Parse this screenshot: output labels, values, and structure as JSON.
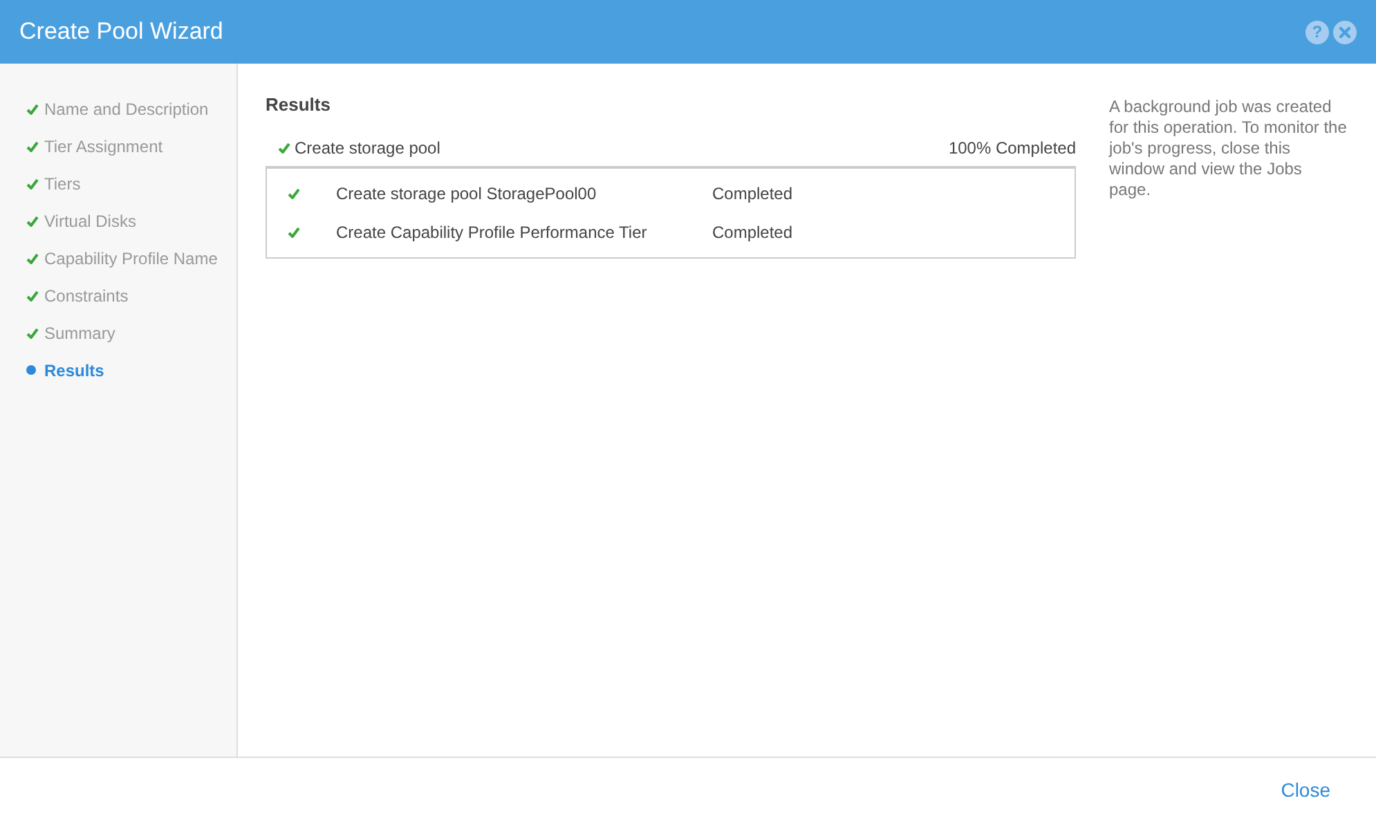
{
  "window": {
    "title": "Create Pool Wizard",
    "help_label": "?"
  },
  "steps": [
    {
      "label": "Name and Description",
      "done": true,
      "selected": false
    },
    {
      "label": "Tier Assignment",
      "done": true,
      "selected": false
    },
    {
      "label": "Tiers",
      "done": true,
      "selected": false
    },
    {
      "label": "Virtual Disks",
      "done": true,
      "selected": false
    },
    {
      "label": "Capability Profile Name",
      "done": true,
      "selected": false
    },
    {
      "label": "Constraints",
      "done": true,
      "selected": false
    },
    {
      "label": "Summary",
      "done": true,
      "selected": false
    },
    {
      "label": "Results",
      "done": false,
      "selected": true
    }
  ],
  "results": {
    "heading": "Results",
    "job": {
      "name": "Create storage pool",
      "done": true,
      "progress": "100% Completed"
    },
    "tasks": [
      {
        "name": "Create storage pool StoragePool00",
        "done": true,
        "state": "Completed"
      },
      {
        "name": "Create Capability Profile Performance Tier",
        "done": true,
        "state": "Completed"
      }
    ]
  },
  "note": "A background job was created for this operation. To monitor the job's progress, close this window and view the Jobs page.",
  "footer": {
    "close_label": "Close"
  }
}
